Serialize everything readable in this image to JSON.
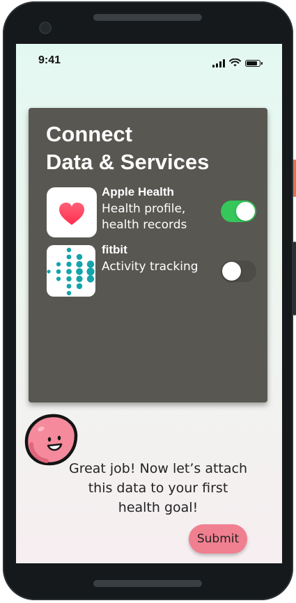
{
  "status_bar": {
    "time": "9:41",
    "icons": [
      "cellular-signal-icon",
      "wifi-icon",
      "battery-icon"
    ],
    "battery_level": 0.9
  },
  "card": {
    "title_line1": "Connect",
    "title_line2": "Data & Services",
    "background_color": "#585751",
    "services": [
      {
        "name": "Apple Health",
        "description": "Health profile, health records",
        "icon": "heart-icon",
        "enabled": true
      },
      {
        "name": "fitbit",
        "description": "Activity tracking",
        "icon": "fitbit-logo-icon",
        "enabled": false
      }
    ]
  },
  "mascot": {
    "icon": "smiling-pink-blob-icon",
    "color": "#f48a9c"
  },
  "message": "Great job! Now let’s attach this data to your first health goal!",
  "submit": {
    "label": "Submit",
    "color": "#f07f90"
  },
  "colors": {
    "toggle_on": "#35c75a",
    "fitbit_teal": "#14a4ab",
    "heart_red": "#ff3355"
  }
}
